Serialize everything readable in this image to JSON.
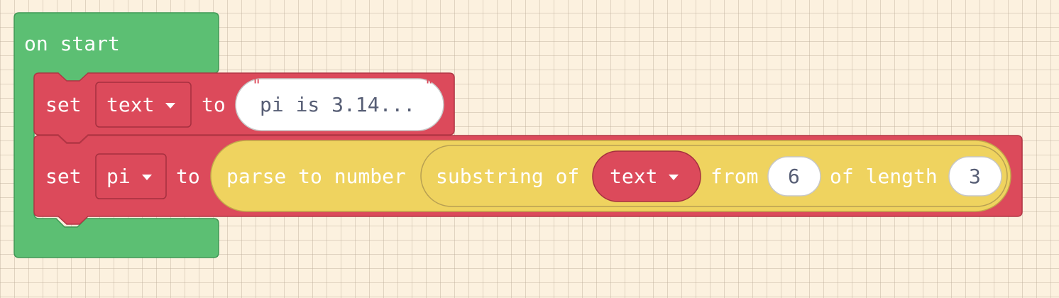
{
  "on_start": {
    "label": "on start"
  },
  "set_text": {
    "set_label": "set",
    "variable": "text",
    "to_label": "to",
    "value": "pi is 3.14..."
  },
  "set_pi": {
    "set_label": "set",
    "variable": "pi",
    "to_label": "to",
    "parse_label": "parse to number",
    "substring_label": "substring of",
    "substring_var": "text",
    "from_label": "from",
    "from_value": "6",
    "length_label": "of length",
    "length_value": "3"
  },
  "colors": {
    "events_green": "#5cbf73",
    "variables_red": "#dc4a5b",
    "text_yellow": "#efd35f",
    "workspace_bg": "#fcf1df",
    "field_text": "#575e75"
  }
}
